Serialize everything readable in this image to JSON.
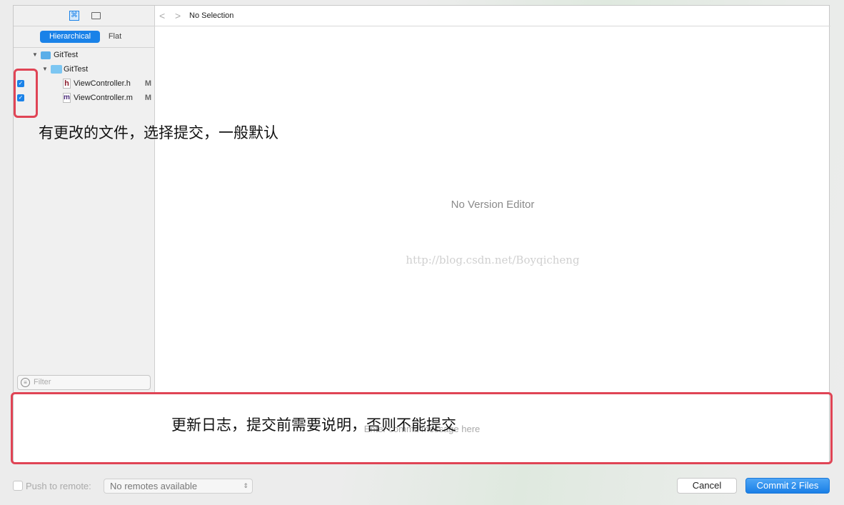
{
  "sidebar": {
    "tabs": [
      {
        "label": "Hierarchical",
        "selected": true
      },
      {
        "label": "Flat",
        "selected": false
      }
    ],
    "tree": [
      {
        "label": "GitTest",
        "type": "project"
      },
      {
        "label": "GitTest",
        "type": "folder"
      },
      {
        "label": "ViewController.h",
        "type": "file",
        "glyph": "h",
        "status": "M",
        "checked": true
      },
      {
        "label": "ViewController.m",
        "type": "file",
        "glyph": "m",
        "status": "M",
        "checked": true
      }
    ],
    "filter_placeholder": "Filter"
  },
  "editor": {
    "breadcrumb": "No Selection",
    "empty_text": "No Version Editor",
    "watermark": "http://blog.csdn.net/Boyqicheng"
  },
  "commit": {
    "placeholder": "Enter commit message here"
  },
  "annotations": {
    "files": "有更改的文件，选择提交，一般默认",
    "message": "更新日志，提交前需要说明，否则不能提交"
  },
  "footer": {
    "push_label": "Push to remote:",
    "push_checked": false,
    "remote_select": "No remotes available",
    "cancel": "Cancel",
    "commit": "Commit 2 Files"
  },
  "colors": {
    "accent": "#1a82e8",
    "annotation": "#e04455"
  }
}
